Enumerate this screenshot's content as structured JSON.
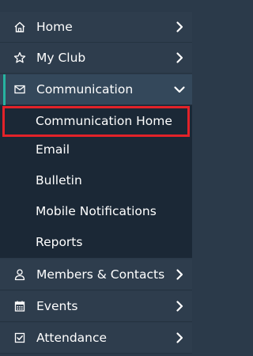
{
  "colors": {
    "sidebar_bg": "#2e3d4d",
    "active_bg": "#34485b",
    "submenu_bg": "#1b2836",
    "active_accent": "#27b3a0",
    "selected_outline": "#e32229",
    "text": "#ffffff"
  },
  "nav": {
    "items": [
      {
        "label": "Home",
        "icon": "home-icon",
        "state": "collapsed"
      },
      {
        "label": "My Club",
        "icon": "star-icon",
        "state": "collapsed"
      },
      {
        "label": "Communication",
        "icon": "envelope-icon",
        "state": "expanded"
      },
      {
        "label": "Members & Contacts",
        "icon": "user-icon",
        "state": "collapsed"
      },
      {
        "label": "Events",
        "icon": "calendar-icon",
        "state": "collapsed"
      },
      {
        "label": "Attendance",
        "icon": "checkbox-icon",
        "state": "collapsed"
      }
    ],
    "communication_submenu": [
      {
        "label": "Communication Home",
        "selected": true
      },
      {
        "label": "Email",
        "selected": false
      },
      {
        "label": "Bulletin",
        "selected": false
      },
      {
        "label": "Mobile Notifications",
        "selected": false
      },
      {
        "label": "Reports",
        "selected": false
      }
    ]
  }
}
